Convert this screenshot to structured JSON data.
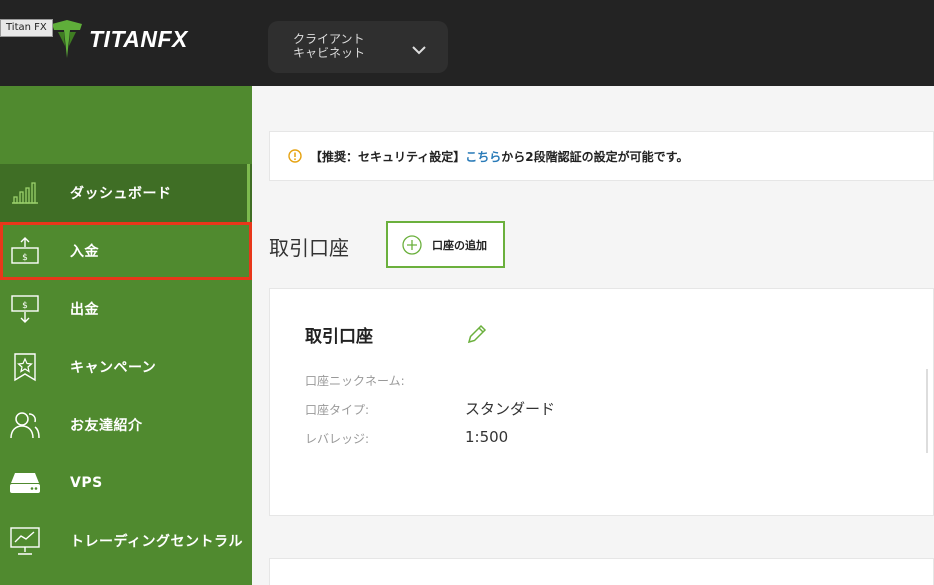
{
  "tooltip": "Titan FX",
  "brand": {
    "name": "TITANFX"
  },
  "header": {
    "cabinet_label": "クライアント\nキャビネット"
  },
  "sidebar": {
    "items": [
      {
        "label": "ダッシュボード",
        "icon": "bar-chart-icon"
      },
      {
        "label": "入金",
        "icon": "deposit-icon"
      },
      {
        "label": "出金",
        "icon": "withdraw-icon"
      },
      {
        "label": "キャンペーン",
        "icon": "star-badge-icon"
      },
      {
        "label": "お友達紹介",
        "icon": "users-icon"
      },
      {
        "label": "VPS",
        "icon": "server-icon"
      },
      {
        "label": "トレーディングセントラル",
        "icon": "monitor-chart-icon"
      }
    ]
  },
  "notice": {
    "before": "【推奨：セキュリティ設定】",
    "link": "こちら",
    "after": "から2段階認証の設定が可能です。"
  },
  "accounts": {
    "title": "取引口座",
    "add_button": "口座の追加"
  },
  "account_card": {
    "title": "取引口座",
    "fields": [
      {
        "label": "口座ニックネーム:",
        "value": ""
      },
      {
        "label": "口座タイプ:",
        "value": "スタンダード"
      },
      {
        "label": "レバレッジ:",
        "value": "1:500"
      }
    ]
  },
  "colors": {
    "sidebar": "#508a2f",
    "sidebar_active": "#3f6e25",
    "accent": "#6bb03d",
    "highlight": "#e8371a",
    "link": "#2a7bb8"
  }
}
